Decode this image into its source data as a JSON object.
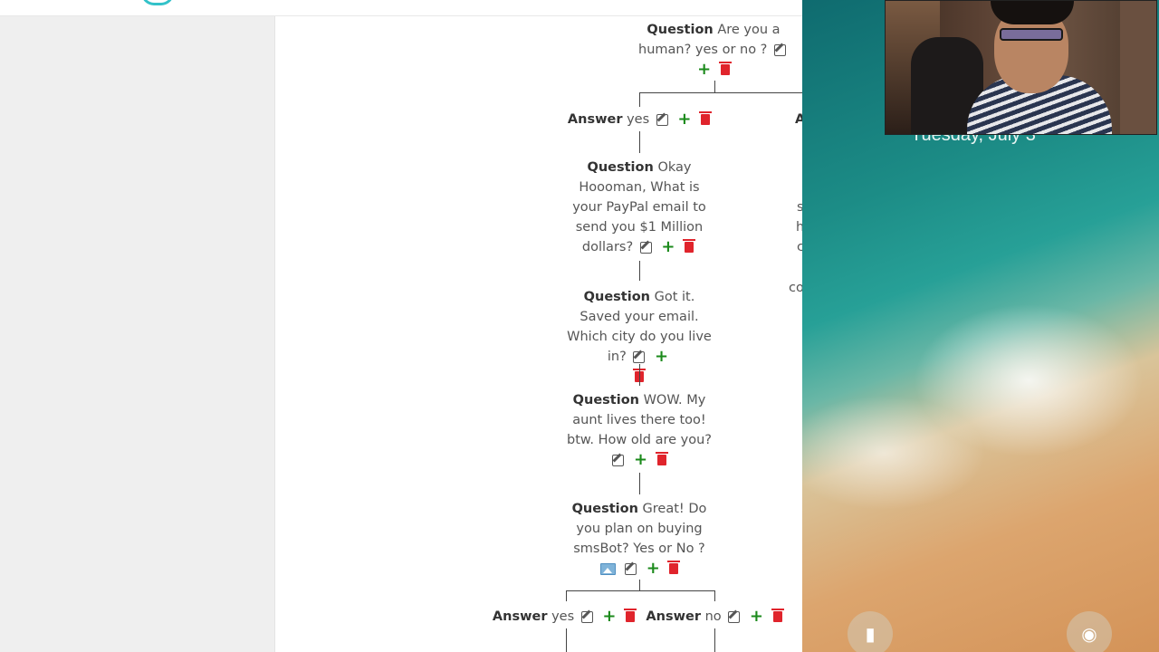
{
  "phone": {
    "date_text": "Tuesday, July 3"
  },
  "tree": {
    "root": {
      "kind": "Question",
      "text": "Are you a human? yes or no ?"
    },
    "answer_yes": {
      "kind": "Answer",
      "text": "yes"
    },
    "right_answer_partial": {
      "kind": "A"
    },
    "right_partial_lines": [
      "s",
      "h",
      "c",
      "co"
    ],
    "q1": {
      "kind": "Question",
      "text": "Okay Hoooman, What is your PayPal email to send you $1 Million dollars?"
    },
    "q2": {
      "kind": "Question",
      "text": "Got it. Saved your email. Which city do you live in?"
    },
    "q3": {
      "kind": "Question",
      "text": "WOW. My aunt lives there too! btw. How old are you?"
    },
    "q4": {
      "kind": "Question",
      "text": "Great! Do you plan on buying smsBot? Yes or No ?"
    },
    "a_yes": {
      "kind": "Answer",
      "text": "yes"
    },
    "a_no": {
      "kind": "Answer",
      "text": "no"
    }
  },
  "icons": {
    "edit": "edit-icon",
    "add": "plus-icon",
    "delete": "trash-icon",
    "image": "image-icon",
    "flashlight": "flashlight-icon",
    "camera": "camera-icon"
  },
  "colors": {
    "add_green": "#1b8a1b",
    "delete_red": "#e0242c",
    "logo_teal": "#33c2c9"
  }
}
